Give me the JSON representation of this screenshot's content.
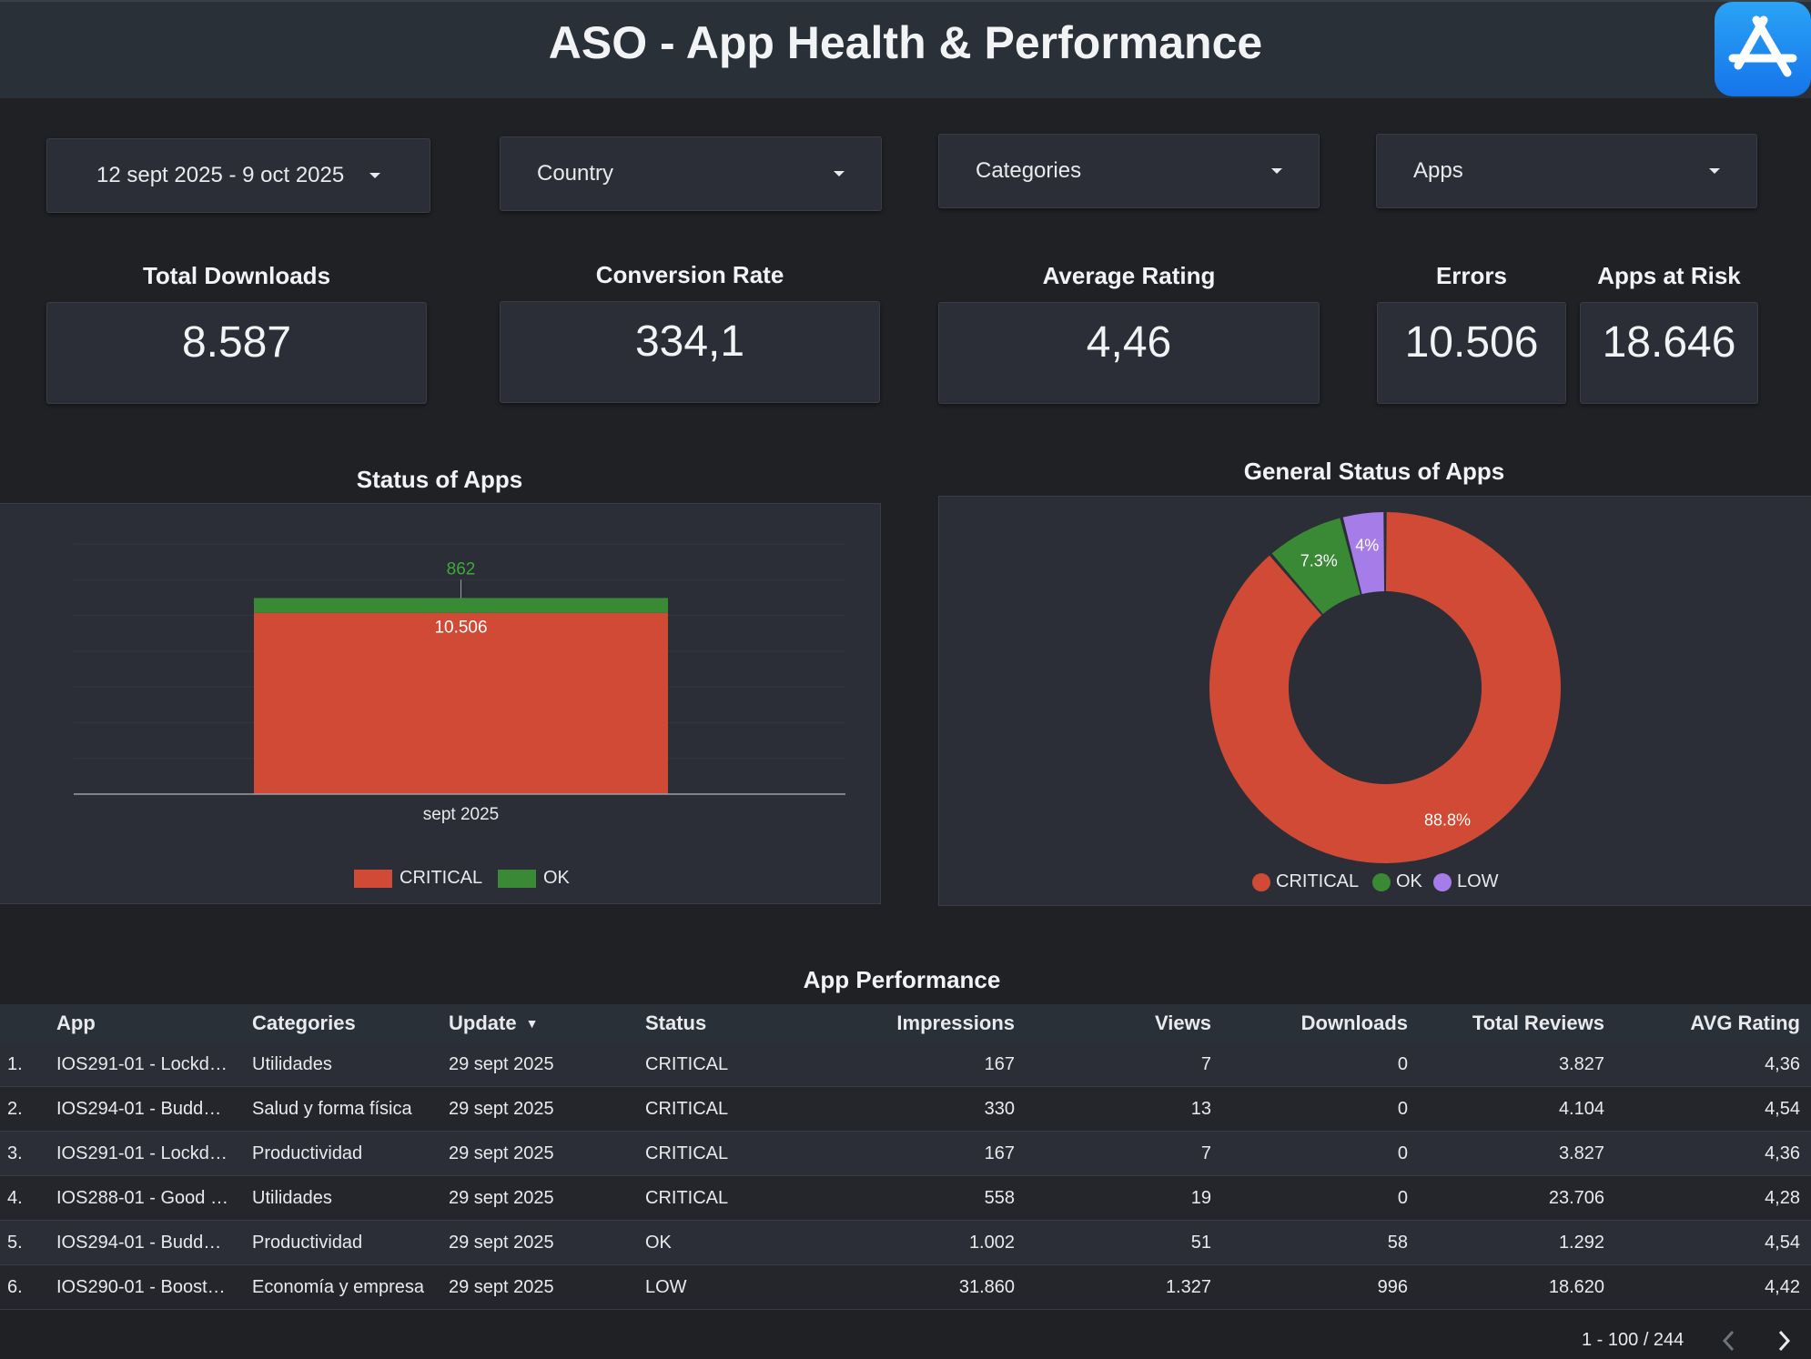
{
  "header": {
    "title": "ASO - App Health & Performance",
    "logo_icon": "app-store-icon"
  },
  "filters": {
    "date_range": "12 sept 2025 - 9 oct 2025",
    "country": "Country",
    "categories": "Categories",
    "apps": "Apps"
  },
  "kpis": {
    "total_downloads": {
      "label": "Total Downloads",
      "value": "8.587"
    },
    "conversion_rate": {
      "label": "Conversion Rate",
      "value": "334,1"
    },
    "average_rating": {
      "label": "Average Rating",
      "value": "4,46"
    },
    "errors": {
      "label": "Errors",
      "value": "10.506"
    },
    "apps_at_risk": {
      "label": "Apps at Risk",
      "value": "18.646"
    }
  },
  "colors": {
    "critical": "#d04a35",
    "ok": "#3a8a35",
    "low": "#a67ce8",
    "background": "#202125",
    "panel": "#2b2e36"
  },
  "status_chart": {
    "title": "Status of Apps",
    "legend": [
      "CRITICAL",
      "OK"
    ]
  },
  "general_status_chart": {
    "title": "General Status of Apps",
    "legend": [
      "CRITICAL",
      "OK",
      "LOW"
    ]
  },
  "chart_data": [
    {
      "type": "bar",
      "title": "Status of Apps",
      "stacked": true,
      "categories": [
        "sept 2025"
      ],
      "series": [
        {
          "name": "CRITICAL",
          "values": [
            10506
          ],
          "label": "10.506"
        },
        {
          "name": "OK",
          "values": [
            862
          ],
          "label": "862"
        }
      ],
      "ylim": [
        0,
        14500
      ],
      "grid": true,
      "legend_position": "bottom"
    },
    {
      "type": "pie",
      "donut": true,
      "title": "General Status of Apps",
      "slices": [
        {
          "name": "CRITICAL",
          "value": 88.8,
          "label": "88.8%"
        },
        {
          "name": "OK",
          "value": 7.3,
          "label": "7.3%"
        },
        {
          "name": "LOW",
          "value": 4.0,
          "label": "4%"
        }
      ],
      "legend_position": "bottom"
    }
  ],
  "table": {
    "title": "App Performance",
    "columns": [
      "App",
      "Categories",
      "Update",
      "Status",
      "Impressions",
      "Views",
      "Downloads",
      "Total Reviews",
      "AVG Rating"
    ],
    "sort_indicator": "▼",
    "rows": [
      {
        "num": "1.",
        "app": "IOS291-01 - Lockd…",
        "category": "Utilidades",
        "update": "29 sept 2025",
        "status": "CRITICAL",
        "impressions": "167",
        "views": "7",
        "downloads": "0",
        "reviews": "3.827",
        "rating": "4,36"
      },
      {
        "num": "2.",
        "app": "IOS294-01 - Budd…",
        "category": "Salud y forma física",
        "update": "29 sept 2025",
        "status": "CRITICAL",
        "impressions": "330",
        "views": "13",
        "downloads": "0",
        "reviews": "4.104",
        "rating": "4,54"
      },
      {
        "num": "3.",
        "app": "IOS291-01 - Lockd…",
        "category": "Productividad",
        "update": "29 sept 2025",
        "status": "CRITICAL",
        "impressions": "167",
        "views": "7",
        "downloads": "0",
        "reviews": "3.827",
        "rating": "4,36"
      },
      {
        "num": "4.",
        "app": "IOS288-01 - Good …",
        "category": "Utilidades",
        "update": "29 sept 2025",
        "status": "CRITICAL",
        "impressions": "558",
        "views": "19",
        "downloads": "0",
        "reviews": "23.706",
        "rating": "4,28"
      },
      {
        "num": "5.",
        "app": "IOS294-01 - Budd…",
        "category": "Productividad",
        "update": "29 sept 2025",
        "status": "OK",
        "impressions": "1.002",
        "views": "51",
        "downloads": "58",
        "reviews": "1.292",
        "rating": "4,54"
      },
      {
        "num": "6.",
        "app": "IOS290-01 - Boost…",
        "category": "Economía y empresa",
        "update": "29 sept 2025",
        "status": "LOW",
        "impressions": "31.860",
        "views": "1.327",
        "downloads": "996",
        "reviews": "18.620",
        "rating": "4,42"
      }
    ],
    "pagination": "1 - 100 / 244"
  }
}
